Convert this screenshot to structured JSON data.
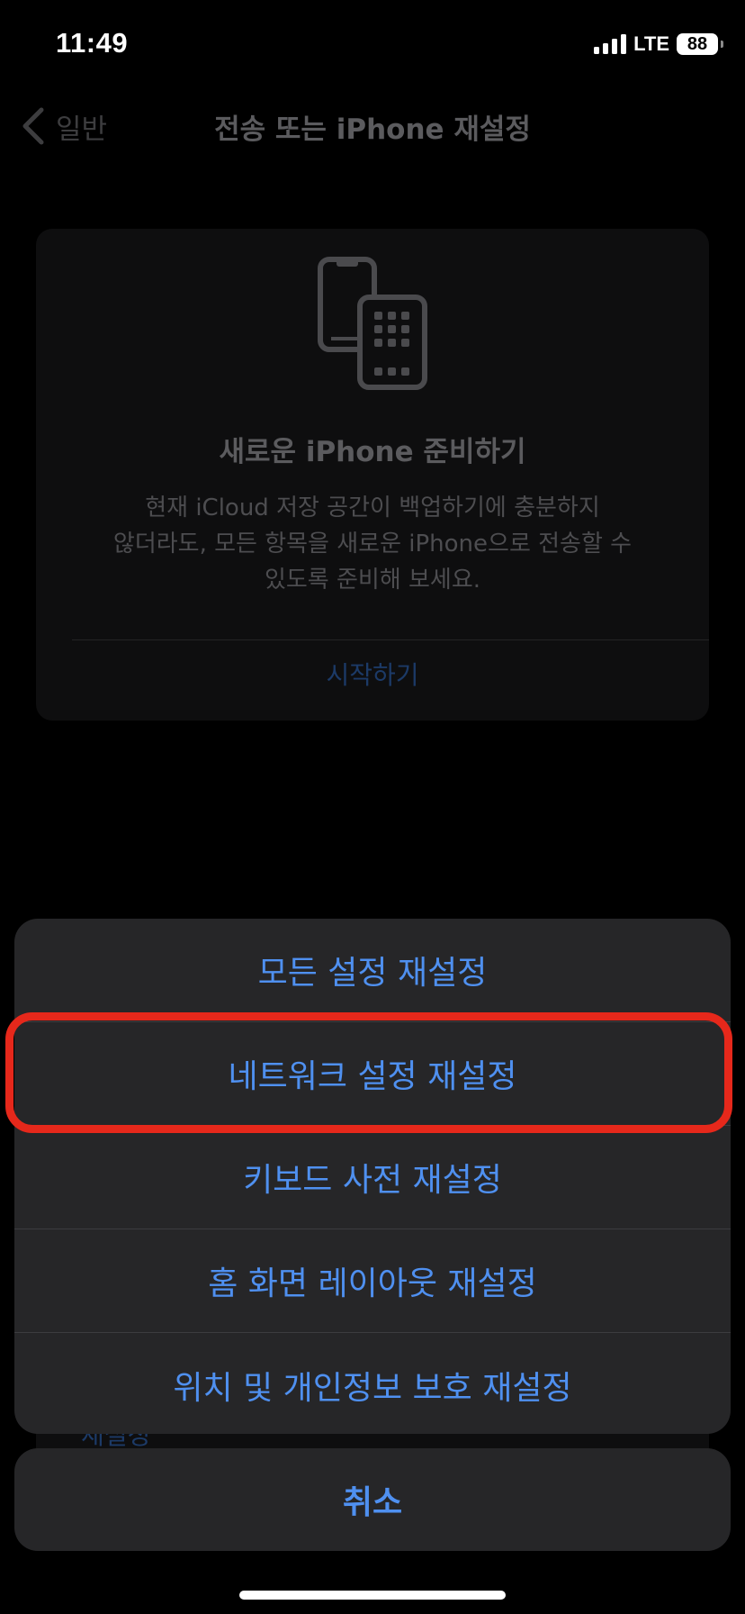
{
  "status_bar": {
    "time": "11:49",
    "network": "LTE",
    "battery": "88",
    "signal_icon": "signal-bars-icon",
    "battery_icon": "battery-icon"
  },
  "nav": {
    "back_label": "일반",
    "title": "전송 또는 iPhone 재설정",
    "back_icon": "chevron-left-icon"
  },
  "transfer_card": {
    "icon": "transfer-phones-icon",
    "title": "새로운 iPhone 준비하기",
    "description_lines": [
      "현재 iCloud 저장 공간이 백업하기에 충분하지",
      "않더라도, 모든 항목을 새로운 iPhone으로 전송할 수",
      "있도록 준비해 보세요."
    ],
    "action_label": "시작하기"
  },
  "underlay": {
    "partial_label": "재설정"
  },
  "action_sheet": {
    "items": [
      {
        "label": "모든 설정 재설정"
      },
      {
        "label": "네트워크 설정 재설정",
        "highlighted": true
      },
      {
        "label": "키보드 사전 재설정"
      },
      {
        "label": "홈 화면 레이아웃 재설정"
      },
      {
        "label": "위치 및 개인정보 보호 재설정"
      }
    ],
    "cancel_label": "취소"
  },
  "colors": {
    "background": "#000000",
    "sheet_background": "#262628",
    "accent_blue": "#4f90f0",
    "highlight_red": "#e6281b"
  }
}
